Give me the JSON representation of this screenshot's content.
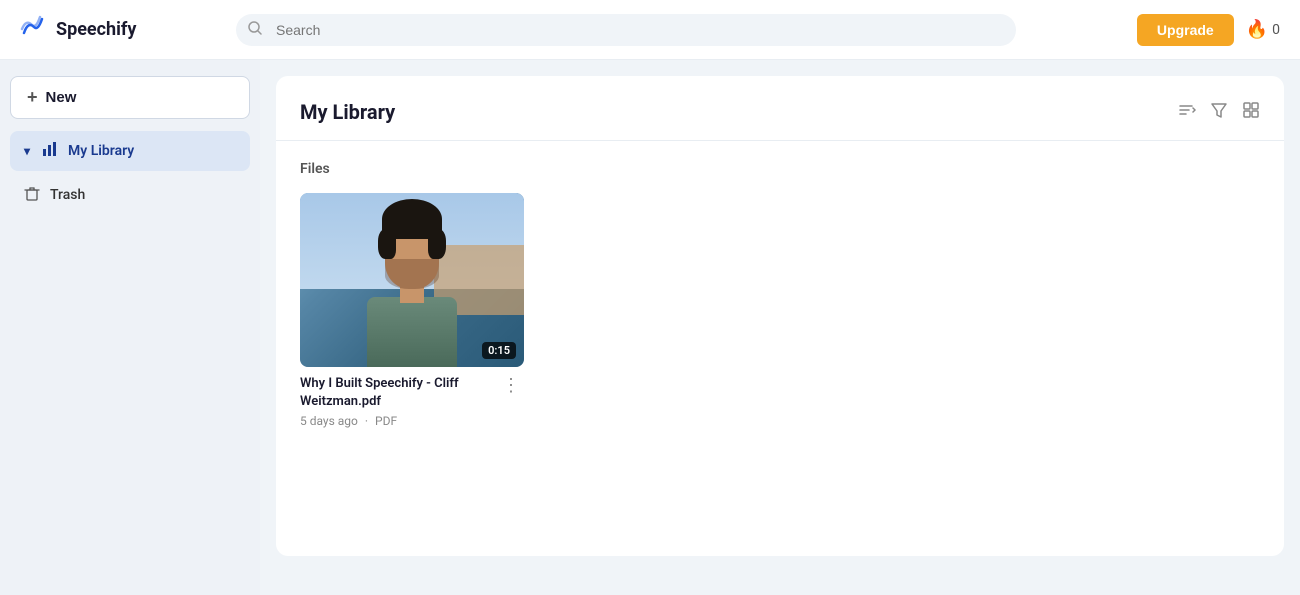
{
  "header": {
    "logo_text": "Speechify",
    "search_placeholder": "Search",
    "upgrade_label": "Upgrade",
    "streak_count": "0"
  },
  "sidebar": {
    "new_button_label": "+ New",
    "items": [
      {
        "id": "my-library",
        "label": "My Library",
        "icon": "📊",
        "active": true
      },
      {
        "id": "trash",
        "label": "Trash",
        "icon": "🗑",
        "active": false
      }
    ]
  },
  "library": {
    "title": "My Library",
    "sections": [
      {
        "label": "Files",
        "items": [
          {
            "name": "Why I Built Speechify - Cliff Weitzman.pdf",
            "age": "5 days ago",
            "type": "PDF",
            "duration": "0:15"
          }
        ]
      }
    ]
  },
  "icons": {
    "search": "🔍",
    "sort": "↕",
    "filter": "⊟",
    "grid": "⊞",
    "more": "⋮",
    "fire": "🔥"
  }
}
